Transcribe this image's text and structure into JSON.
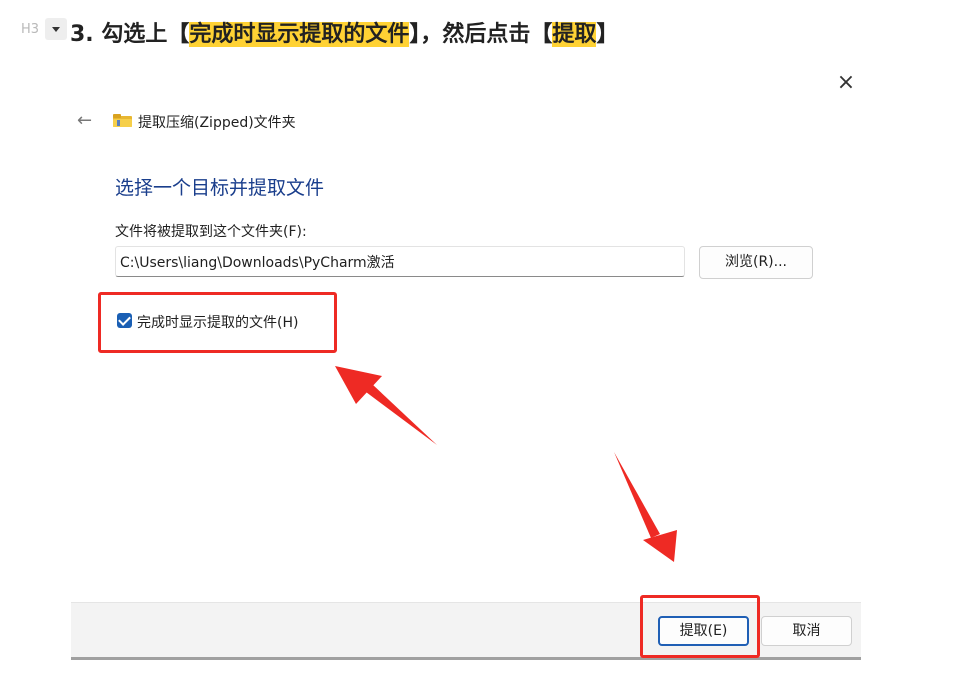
{
  "heading": {
    "level_tag": "H3",
    "prefix": "3. 勾选上【",
    "highlight1": "完成时显示提取的文件",
    "middle": "】，然后点击【",
    "highlight2": "提取",
    "suffix": "】"
  },
  "dialog": {
    "close_icon": "×",
    "back_icon": "←",
    "breadcrumb": "提取压缩(Zipped)文件夹",
    "title": "选择一个目标并提取文件",
    "destination_label": "文件将被提取到这个文件夹(F):",
    "destination_value": "C:\\Users\\liang\\Downloads\\PyCharm激活",
    "browse_label": "浏览(R)...",
    "show_files_label": "完成时显示提取的文件(H)",
    "show_files_checked": true,
    "extract_label": "提取(E)",
    "cancel_label": "取消"
  },
  "colors": {
    "highlight": "#ffd234",
    "annotation": "#ee2a24",
    "title": "#1a3e8c",
    "accent": "#1a5fb4"
  }
}
